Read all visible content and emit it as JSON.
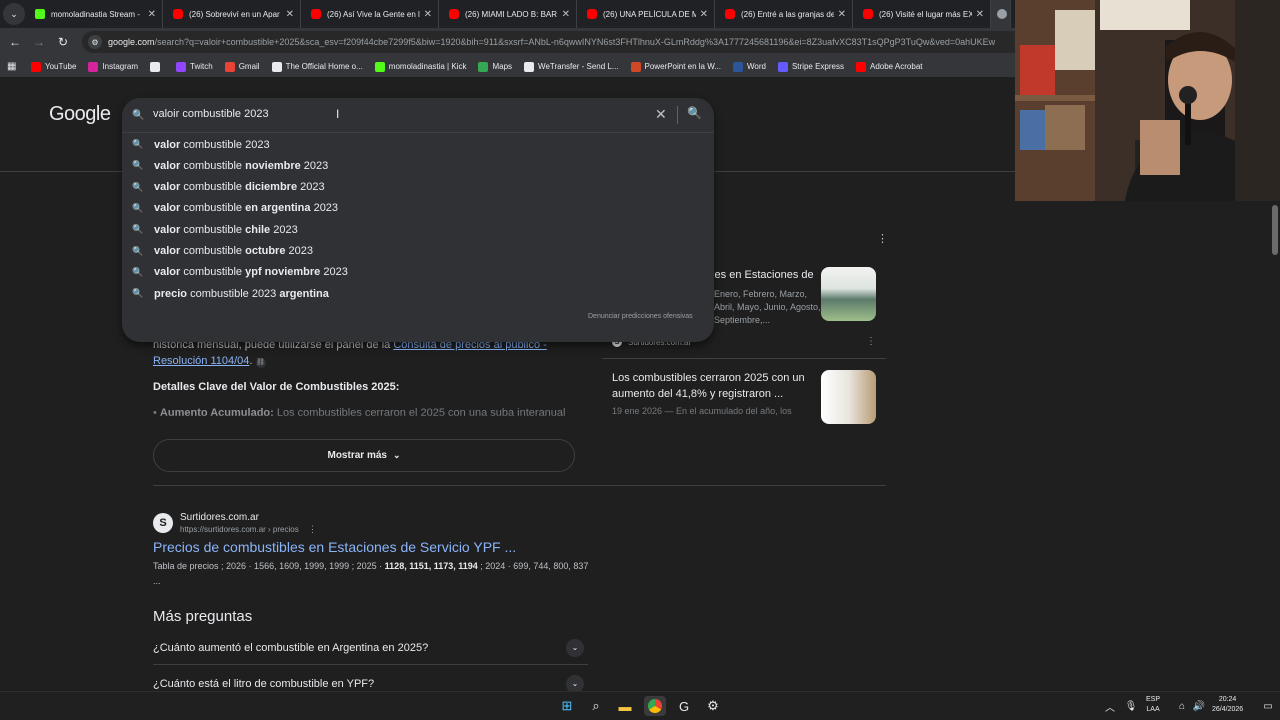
{
  "tabs": [
    {
      "title": "momoladinastia Stream -",
      "icon": "kick-icon"
    },
    {
      "title": "(26) Sobreviví en un Apar",
      "icon": "youtube-icon"
    },
    {
      "title": "(26) Así Vive la Gente en l",
      "icon": "youtube-icon"
    },
    {
      "title": "(26) MIAMI LADO B: BAR",
      "icon": "youtube-icon"
    },
    {
      "title": "(26) UNA PELÍCULA DE M",
      "icon": "youtube-icon"
    },
    {
      "title": "(26) Entré a las granjas de",
      "icon": "youtube-icon"
    },
    {
      "title": "(26) Visité el lugar más EX",
      "icon": "youtube-icon"
    }
  ],
  "address": {
    "host": "google.com",
    "path": "/search?q=valoir+combustible+2025&sca_esv=f209f44cbe7299f5&biw=1920&bih=911&sxsrf=ANbL-n6qwwINYN6st3FHTlhnuX-GLmRddg%3A1777245681196&ei=8Z3uafvXC83T1sQPgP3TuQw&ved=0ahUKEw"
  },
  "bookmarks": [
    {
      "label": "YouTube",
      "color": "#ff0000"
    },
    {
      "label": "Instagram",
      "color": "#d6249f"
    },
    {
      "label": "",
      "color": "#e8eaed",
      "icon": "x-icon"
    },
    {
      "label": "Twitch",
      "color": "#9146ff"
    },
    {
      "label": "Gmail",
      "color": "#ea4335"
    },
    {
      "label": "The Official Home o...",
      "color": "#e8eaed"
    },
    {
      "label": "momoladinastia | Kick",
      "color": "#53fc18"
    },
    {
      "label": "Maps",
      "color": "#34a853"
    },
    {
      "label": "WeTransfer - Send L...",
      "color": "#e8eaed"
    },
    {
      "label": "PowerPoint en la W...",
      "color": "#d24726"
    },
    {
      "label": "Word",
      "color": "#2b579a"
    },
    {
      "label": "Stripe Express",
      "color": "#635bff"
    },
    {
      "label": "Adobe Acrobat",
      "color": "#ff0000"
    }
  ],
  "google_logo": "Google",
  "search": {
    "query": "valoir combustible 2023",
    "report": "Denunciar predicciones ofensivas",
    "suggestions": [
      [
        [
          "valor",
          true
        ],
        [
          " combustible 2023",
          false
        ]
      ],
      [
        [
          "valor",
          true
        ],
        [
          " combustible ",
          false
        ],
        [
          "noviembre",
          true
        ],
        [
          " 2023",
          false
        ]
      ],
      [
        [
          "valor",
          true
        ],
        [
          " combustible ",
          false
        ],
        [
          "diciembre",
          true
        ],
        [
          " 2023",
          false
        ]
      ],
      [
        [
          "valor",
          true
        ],
        [
          " combustible ",
          false
        ],
        [
          "en argentina",
          true
        ],
        [
          " 2023",
          false
        ]
      ],
      [
        [
          "valor",
          true
        ],
        [
          " combustible ",
          false
        ],
        [
          "chile",
          true
        ],
        [
          " 2023",
          false
        ]
      ],
      [
        [
          "valor",
          true
        ],
        [
          " combustible ",
          false
        ],
        [
          "octubre",
          true
        ],
        [
          " 2023",
          false
        ]
      ],
      [
        [
          "valor",
          true
        ],
        [
          " combustible ",
          false
        ],
        [
          "ypf noviembre",
          true
        ],
        [
          " 2023",
          false
        ]
      ],
      [
        [
          "precio",
          true
        ],
        [
          " combustible 2023 ",
          false
        ],
        [
          "argentina",
          true
        ]
      ]
    ]
  },
  "ai_overview": {
    "text_part1": "cercana a los $1.371 y la Premium en torno a los $1.999. Para consultar la evolución histórica mensual, puede utilizarse el panel de la ",
    "link": "Consulta de precios al público - Resolución 1104/04",
    "text_part2": ".",
    "heading": "Detalles Clave del Valor de Combustibles 2025:",
    "bullet_bold": "Aumento Acumulado:",
    "bullet_text": " Los combustibles cerraron el 2025 con una suba interanual",
    "more_button": "Mostrar más"
  },
  "result": {
    "site": "Surtidores.com.ar",
    "url": "https://surtidores.com.ar › precios",
    "title": "Precios de combustibles en Estaciones de Servicio YPF ...",
    "snippet_a": "Tabla de precios ; 2026 · 1566, 1609, 1999, 1999 ; 2025 · ",
    "snippet_bold": "1128, 1151, 1173, 1194",
    "snippet_b": " ; 2024 · 699, 744, 800, 837 ..."
  },
  "more_questions": {
    "heading": "Más preguntas",
    "items": [
      "¿Cuánto aumentó el combustible en Argentina en 2025?",
      "¿Cuánto está el litro de combustible en YPF?"
    ]
  },
  "side_cards": [
    {
      "title": "bles en Estaciones de",
      "snippet": "Enero, Febrero, Marzo, Abril, Mayo, Junio, Agosto, Septiembre,...",
      "source": "Surtidores.com.ar"
    },
    {
      "title": "Los combustibles cerraron 2025 con un aumento del 41,8% y registraron ...",
      "snippet": "19 ene 2026 — En el acumulado del año, los"
    }
  ],
  "taskbar": {
    "lang_top": "ESP",
    "lang_bottom": "LAA",
    "time": "20:24",
    "date": "26/4/2026"
  },
  "colors": {
    "link": "#8ab4f8",
    "page_bg": "#1f1f1f",
    "searchbox_bg": "#303134"
  }
}
